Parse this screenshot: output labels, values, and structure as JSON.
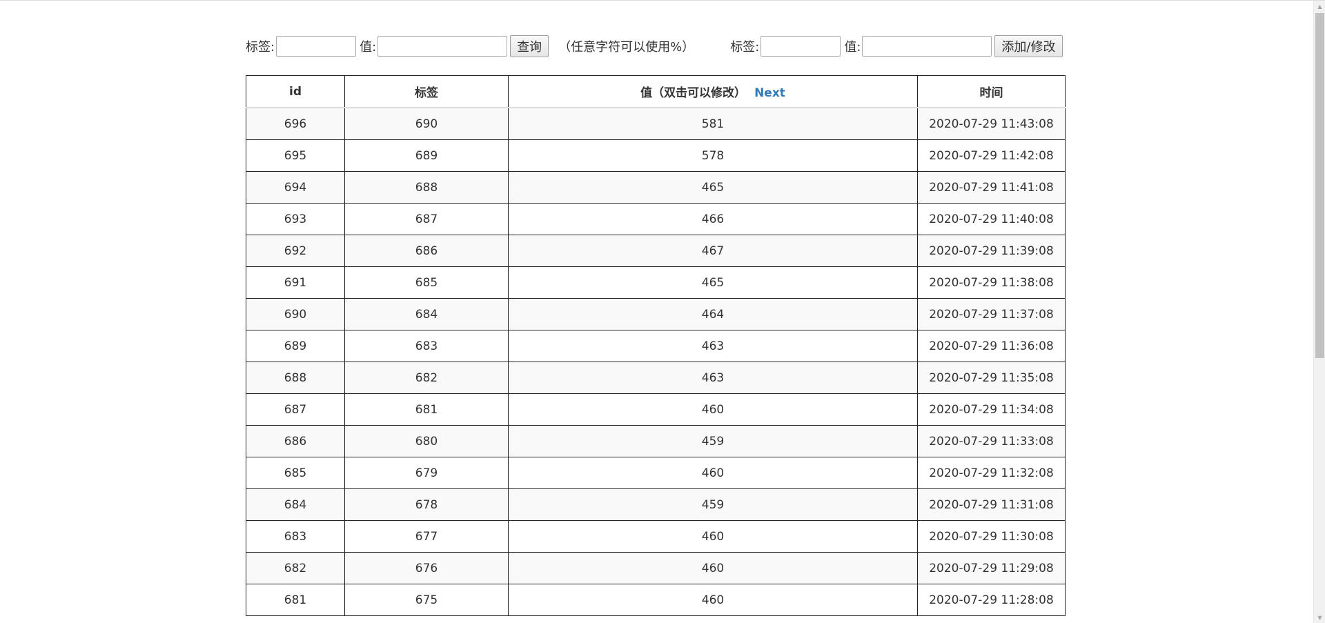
{
  "search_form": {
    "tag_label": "标签:",
    "value_label": "值:",
    "tag_value": "",
    "value_value": "",
    "query_button": "查询",
    "hint": "（任意字符可以使用%）"
  },
  "edit_form": {
    "tag_label": "标签:",
    "value_label": "值:",
    "tag_value": "",
    "value_value": "",
    "submit_button": "添加/修改"
  },
  "table": {
    "columns": {
      "id": "id",
      "tag": "标签",
      "value": "值（双击可以修改）",
      "next": "Next",
      "time": "时间"
    },
    "rows": [
      {
        "id": "696",
        "tag": "690",
        "value": "581",
        "time": "2020-07-29 11:43:08"
      },
      {
        "id": "695",
        "tag": "689",
        "value": "578",
        "time": "2020-07-29 11:42:08"
      },
      {
        "id": "694",
        "tag": "688",
        "value": "465",
        "time": "2020-07-29 11:41:08"
      },
      {
        "id": "693",
        "tag": "687",
        "value": "466",
        "time": "2020-07-29 11:40:08"
      },
      {
        "id": "692",
        "tag": "686",
        "value": "467",
        "time": "2020-07-29 11:39:08"
      },
      {
        "id": "691",
        "tag": "685",
        "value": "465",
        "time": "2020-07-29 11:38:08"
      },
      {
        "id": "690",
        "tag": "684",
        "value": "464",
        "time": "2020-07-29 11:37:08"
      },
      {
        "id": "689",
        "tag": "683",
        "value": "463",
        "time": "2020-07-29 11:36:08"
      },
      {
        "id": "688",
        "tag": "682",
        "value": "463",
        "time": "2020-07-29 11:35:08"
      },
      {
        "id": "687",
        "tag": "681",
        "value": "460",
        "time": "2020-07-29 11:34:08"
      },
      {
        "id": "686",
        "tag": "680",
        "value": "459",
        "time": "2020-07-29 11:33:08"
      },
      {
        "id": "685",
        "tag": "679",
        "value": "460",
        "time": "2020-07-29 11:32:08"
      },
      {
        "id": "684",
        "tag": "678",
        "value": "459",
        "time": "2020-07-29 11:31:08"
      },
      {
        "id": "683",
        "tag": "677",
        "value": "460",
        "time": "2020-07-29 11:30:08"
      },
      {
        "id": "682",
        "tag": "676",
        "value": "460",
        "time": "2020-07-29 11:29:08"
      },
      {
        "id": "681",
        "tag": "675",
        "value": "460",
        "time": "2020-07-29 11:28:08"
      }
    ]
  },
  "colors": {
    "link": "#337ab7",
    "row_striped": "#f9f9f9",
    "border": "#222222"
  }
}
